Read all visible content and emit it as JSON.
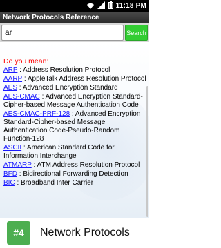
{
  "status_bar": {
    "time": "11:18 PM",
    "icons": [
      "wifi-icon",
      "signal-icon",
      "battery-icon"
    ]
  },
  "title_bar": {
    "title": "Network Protocols Reference"
  },
  "search": {
    "value": "ar",
    "button_label": "Search"
  },
  "results": {
    "heading": "Do you mean:",
    "entries": [
      {
        "term": "ARP",
        "definition": " : Address Resolution Protocol"
      },
      {
        "term": "AARP",
        "definition": " : AppleTalk Address Resolution Protocol"
      },
      {
        "term": "AES",
        "definition": " : Advanced Encryption Standard"
      },
      {
        "term": "AES-CMAC",
        "definition": " : Advanced Encryption Standard-Cipher-based Message Authentication Code"
      },
      {
        "term": "AES-CMAC-PRF-128",
        "definition": " : Advanced Encryption Standard-Cipher-based Message Authentication Code-Pseudo-Random Function-128"
      },
      {
        "term": "ASCII",
        "definition": " : American Standard Code for Information Interchange"
      },
      {
        "term": "ATMARP",
        "definition": " : ATM Address Resolution Protocol"
      },
      {
        "term": "BFD",
        "definition": " : Bidirectional Forwarding Detection"
      },
      {
        "term": "BIC",
        "definition": " : Broadband Inter Carrier"
      }
    ]
  },
  "footer": {
    "badge": "#4",
    "app_name": "Network Protocols"
  },
  "colors": {
    "link": "#1a1aff",
    "heading_red": "#ff0000",
    "search_button": "#32cd32",
    "badge_green": "#4cae50"
  }
}
